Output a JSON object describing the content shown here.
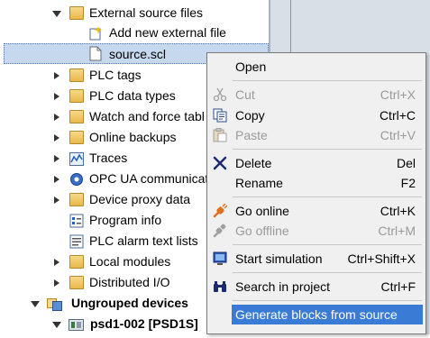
{
  "tree": {
    "items": [
      {
        "label": "External source files",
        "icon": "folder-icon",
        "arrow": "down"
      },
      {
        "label": "Add new external file",
        "icon": "add-file-icon",
        "arrow": ""
      },
      {
        "label": "source.scl",
        "icon": "file-icon",
        "arrow": ""
      },
      {
        "label": "PLC tags",
        "icon": "plc-tags-icon",
        "arrow": "right"
      },
      {
        "label": "PLC data types",
        "icon": "data-types-icon",
        "arrow": "right"
      },
      {
        "label": "Watch and force tabl",
        "icon": "watch-table-icon",
        "arrow": "right"
      },
      {
        "label": "Online backups",
        "icon": "folder-icon",
        "arrow": "right"
      },
      {
        "label": "Traces",
        "icon": "traces-icon",
        "arrow": "right"
      },
      {
        "label": "OPC UA communicat",
        "icon": "opc-ua-icon",
        "arrow": "right"
      },
      {
        "label": "Device proxy data",
        "icon": "folder-icon",
        "arrow": "right"
      },
      {
        "label": "Program info",
        "icon": "program-info-icon",
        "arrow": ""
      },
      {
        "label": "PLC alarm text lists",
        "icon": "alarm-text-icon",
        "arrow": ""
      },
      {
        "label": "Local modules",
        "icon": "folder-icon",
        "arrow": "right"
      },
      {
        "label": "Distributed I/O",
        "icon": "folder-icon",
        "arrow": "right"
      },
      {
        "label": "Ungrouped devices",
        "icon": "ungrouped-devices-icon",
        "arrow": "down"
      },
      {
        "label": "psd1-002 [PSD1S]",
        "icon": "device-icon",
        "arrow": "down"
      }
    ]
  },
  "context_menu": {
    "items": [
      {
        "label": "Open",
        "shortcut": "",
        "icon": "",
        "disabled": false
      },
      {
        "label": "Cut",
        "shortcut": "Ctrl+X",
        "icon": "scissors-icon",
        "disabled": true
      },
      {
        "label": "Copy",
        "shortcut": "Ctrl+C",
        "icon": "copy-icon",
        "disabled": false
      },
      {
        "label": "Paste",
        "shortcut": "Ctrl+V",
        "icon": "paste-icon",
        "disabled": true
      },
      {
        "label": "Delete",
        "shortcut": "Del",
        "icon": "delete-x-icon",
        "disabled": false
      },
      {
        "label": "Rename",
        "shortcut": "F2",
        "icon": "",
        "disabled": false
      },
      {
        "label": "Go online",
        "shortcut": "Ctrl+K",
        "icon": "go-online-icon",
        "disabled": false
      },
      {
        "label": "Go offline",
        "shortcut": "Ctrl+M",
        "icon": "go-offline-icon",
        "disabled": true
      },
      {
        "label": "Start simulation",
        "shortcut": "Ctrl+Shift+X",
        "icon": "simulation-icon",
        "disabled": false
      },
      {
        "label": "Search in project",
        "shortcut": "Ctrl+F",
        "icon": "binoculars-icon",
        "disabled": false
      },
      {
        "label": "Generate blocks from source",
        "shortcut": "",
        "icon": "",
        "disabled": false
      }
    ]
  },
  "colors": {
    "highlight": "#3a7bd5",
    "selected_row": "#c5d8ee",
    "delete_x": "#1a2a6e",
    "go_online": "#e07020"
  }
}
